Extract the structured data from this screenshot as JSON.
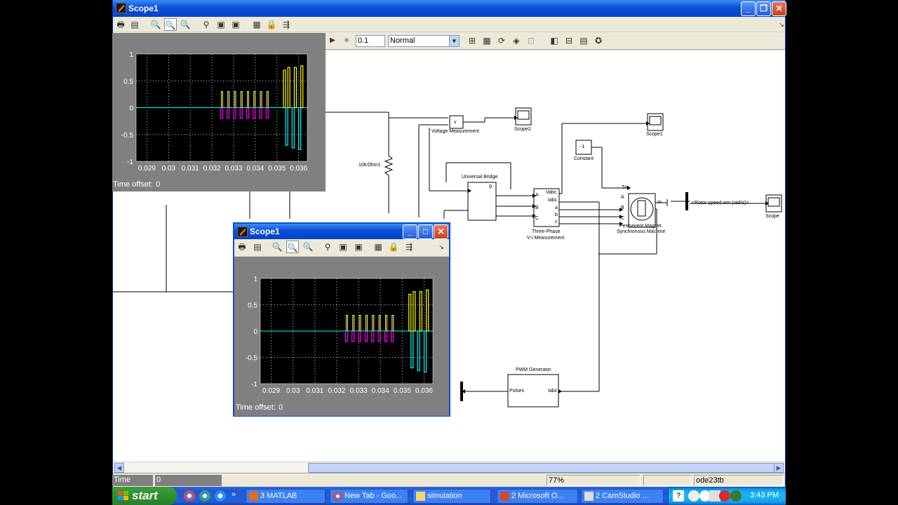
{
  "main_window": {
    "title": "Scope1",
    "toolbar2": {
      "stop_time": "0.1",
      "sim_mode": "Normal"
    },
    "labels": {
      "voltage_measurement": "Voltage Measurement",
      "scope2": "Scope2",
      "scope1": "Scope1",
      "resistor": "10KOhm1",
      "universal_bridge": "Universal Bridge",
      "three_phase": "Three-Phase",
      "vi_measurement": "V-I Measurement",
      "constant": "Constant",
      "constant_value": "-1",
      "pmsm_line1": "Permanent Magnet",
      "pmsm_line2": "Synchronous Machine",
      "rotor_speed": "<Rotor speed wm (rad/s)>",
      "scope": "Scope",
      "pwm_generator": "PWM Generator",
      "pulses": "Pulses",
      "iabc": "Iabc",
      "vabc": "Vabc",
      "iabc_vi": "Iabc",
      "port_a": "a",
      "port_b": "b",
      "port_c": "c",
      "port_A": "A",
      "port_B": "B",
      "port_C": "C",
      "tm": "Tm",
      "m": "m",
      "v": "v",
      "g": "g"
    },
    "status": {
      "time_offset_label": "Time offset:",
      "time_offset_value": "0",
      "zoom": "77%",
      "solver": "ode23tb"
    }
  },
  "scope_window": {
    "title": "Scope1",
    "time_offset_label": "Time offset:",
    "time_offset_value": "0"
  },
  "ghost_scope": {
    "time_offset_label": "Time offset:",
    "time_offset_value": "0"
  },
  "chart_data": [
    {
      "type": "line",
      "ylim": [
        -1,
        1
      ],
      "xlim": [
        0.0285,
        0.0364
      ],
      "x_ticks": [
        "0.029",
        "0.03",
        "0.031",
        "0.032",
        "0.033",
        "0.034",
        "0.035",
        "0.036"
      ],
      "y_ticks": [
        "1",
        "0.5",
        "0",
        "-0.5",
        "-1"
      ],
      "grid": true,
      "series": [
        {
          "color": "#ffff00",
          "x": [
            0.0353,
            0.0355,
            0.0358,
            0.0361
          ],
          "values": [
            0.7,
            0.75,
            0.75,
            0.78
          ]
        },
        {
          "color": "#ff00ff",
          "x": [
            0.0324,
            0.0327,
            0.033,
            0.0333,
            0.0336,
            0.0339,
            0.0342,
            0.0345
          ],
          "values": [
            -0.2,
            -0.2,
            -0.2,
            -0.2,
            -0.2,
            -0.2,
            -0.2,
            -0.2
          ]
        },
        {
          "color": "#00ffff",
          "x": [
            0.0354,
            0.0357,
            0.036
          ],
          "values": [
            -0.7,
            -0.75,
            -0.78
          ]
        }
      ]
    }
  ],
  "taskbar": {
    "start_label": "start",
    "tasks": [
      "3 MATLAB",
      "New Tab - Goo...",
      "simulation",
      "2 Microsoft O...",
      "2 CamStudio ..."
    ],
    "clock": "3:43 PM"
  },
  "colors": {
    "xp_blue": "#0a4fd8",
    "scope_bg": "#000000",
    "trace_yellow": "#ffff00",
    "trace_magenta": "#ff00ff",
    "trace_cyan": "#00ffff"
  }
}
